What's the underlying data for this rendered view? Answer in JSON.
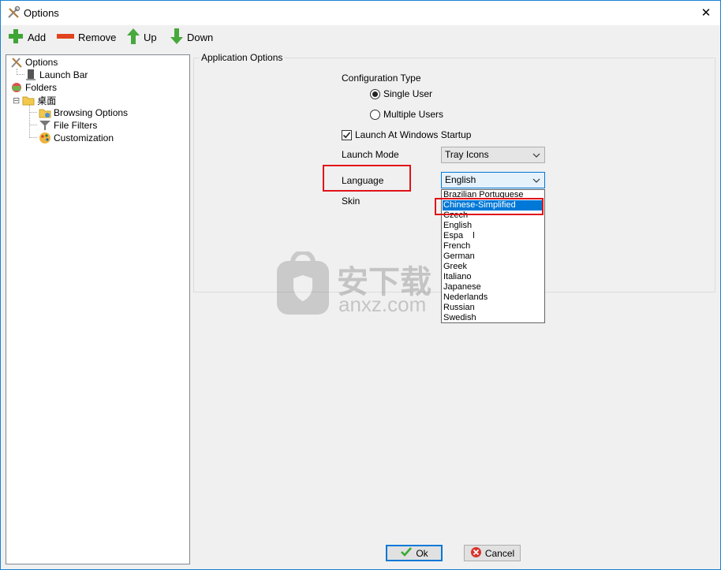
{
  "window": {
    "title": "Options",
    "close_glyph": "✕"
  },
  "toolbar": {
    "add_label": "Add",
    "remove_label": "Remove",
    "up_label": "Up",
    "down_label": "Down"
  },
  "tree": {
    "root": "Options",
    "launch_bar": "Launch Bar",
    "folders": "Folders",
    "desktop": "桌面",
    "browsing_options": "Browsing Options",
    "file_filters": "File Filters",
    "customization": "Customization",
    "expander": "⊟"
  },
  "group": {
    "legend": "Application Options",
    "config_type_label": "Configuration Type",
    "single_user_label": "Single User",
    "multiple_users_label": "Multiple Users",
    "launch_startup_label": "Launch At Windows Startup",
    "launch_mode_label": "Launch Mode",
    "launch_mode_value": "Tray Icons",
    "language_label": "Language",
    "language_value": "English",
    "skin_label": "Skin"
  },
  "state": {
    "single_user_selected": true,
    "launch_at_startup_checked": true
  },
  "language_options": [
    "Brazilian Portuguese",
    "Chinese-Simplified",
    "Czech",
    "English",
    "Espa    l",
    "French",
    "German",
    "Greek",
    "Italiano",
    "Japanese",
    "Nederlands",
    "Russian",
    "Swedish"
  ],
  "language_highlighted": "Chinese-Simplified",
  "buttons": {
    "ok_label": "Ok",
    "cancel_label": "Cancel"
  },
  "watermark": {
    "text_cn": "安下载",
    "text_en": "anxz.com"
  },
  "colors": {
    "accent": "#0078d7",
    "highlight_box": "#e1131a"
  }
}
